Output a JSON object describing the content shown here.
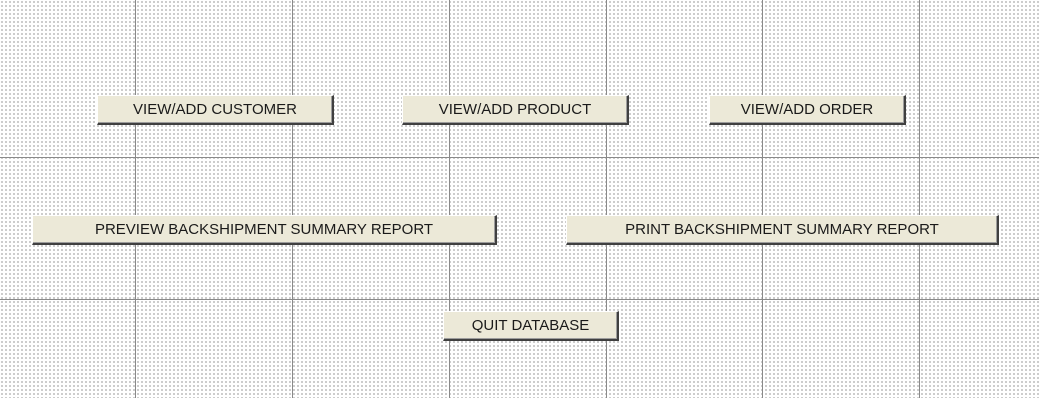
{
  "form": {
    "buttons": {
      "view_add_customer": "VIEW/ADD CUSTOMER",
      "view_add_product": "VIEW/ADD PRODUCT",
      "view_add_order": "VIEW/ADD ORDER",
      "preview_backshipment_report": "PREVIEW BACKSHIPMENT SUMMARY REPORT",
      "print_backshipment_report": "PRINT BACKSHIPMENT SUMMARY REPORT",
      "quit_database": "QUIT DATABASE"
    }
  },
  "colors": {
    "button_face": "#ece9d8",
    "grid_line": "#8a8a8a",
    "grid_dot": "#8c8c8c",
    "background": "#ffffff"
  }
}
